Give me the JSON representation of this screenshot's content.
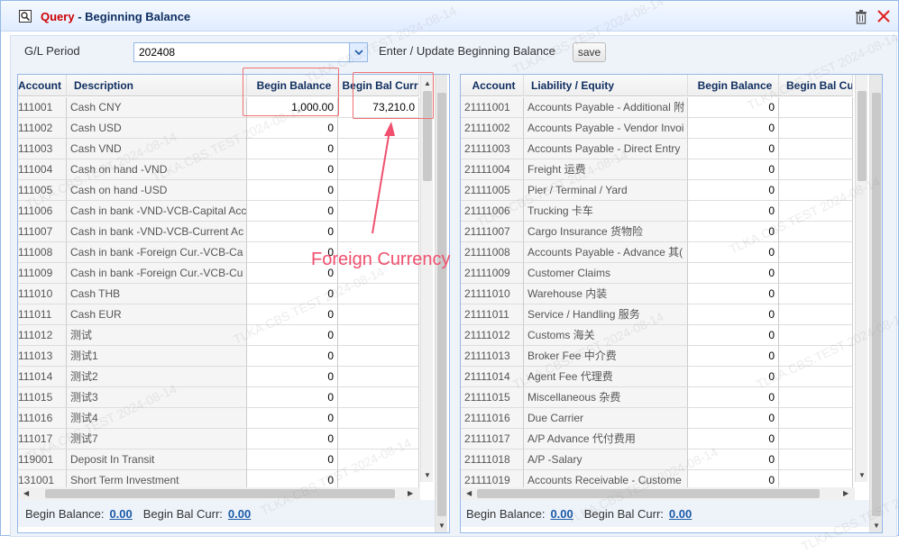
{
  "window": {
    "title_prefix": "Query",
    "title_sep": " - ",
    "title_main": "Beginning Balance"
  },
  "filter": {
    "period_label": "G/L Period",
    "period_value": "202408",
    "enter_label": "Enter / Update Beginning Balance",
    "save_label": "save"
  },
  "annotation": "Foreign Currency",
  "watermark": "TLKA.CBS.TEST 2024-08-14",
  "left_grid": {
    "headers": [
      "Account",
      "Description",
      "Begin Balance",
      "Begin Bal Curr"
    ],
    "rows": [
      [
        "111001",
        "Cash CNY",
        "1,000.00",
        "73,210.0"
      ],
      [
        "111002",
        "Cash USD",
        "0",
        ""
      ],
      [
        "111003",
        "Cash VND",
        "0",
        ""
      ],
      [
        "111004",
        "Cash on hand -VND",
        "0",
        ""
      ],
      [
        "111005",
        "Cash on hand -USD",
        "0",
        ""
      ],
      [
        "111006",
        "Cash in bank -VND-VCB-Capital Acc",
        "0",
        ""
      ],
      [
        "111007",
        "Cash in bank -VND-VCB-Current Ac",
        "0",
        ""
      ],
      [
        "111008",
        "Cash in bank -Foreign Cur.-VCB-Ca",
        "0",
        ""
      ],
      [
        "111009",
        "Cash in bank -Foreign Cur.-VCB-Cu",
        "0",
        ""
      ],
      [
        "111010",
        "Cash THB",
        "0",
        ""
      ],
      [
        "111011",
        "Cash EUR",
        "0",
        ""
      ],
      [
        "111012",
        "测试",
        "0",
        ""
      ],
      [
        "111013",
        "测试1",
        "0",
        ""
      ],
      [
        "111014",
        "测试2",
        "0",
        ""
      ],
      [
        "111015",
        "测试3",
        "0",
        ""
      ],
      [
        "111016",
        "测试4",
        "0",
        ""
      ],
      [
        "111017",
        "测试7",
        "0",
        ""
      ],
      [
        "119001",
        "Deposit In Transit",
        "0",
        ""
      ],
      [
        "131001",
        "Short Term Investment",
        "0",
        ""
      ]
    ],
    "footer": {
      "begin_balance_label": "Begin Balance:",
      "begin_balance_value": "0.00",
      "begin_bal_curr_label": "Begin Bal Curr:",
      "begin_bal_curr_value": "0.00"
    }
  },
  "right_grid": {
    "headers": [
      "Account",
      "Liability / Equity",
      "Begin Balance",
      "Begin Bal Cu"
    ],
    "rows": [
      [
        "21111001",
        "Accounts Payable - Additional 附",
        "0",
        ""
      ],
      [
        "21111002",
        "Accounts Payable - Vendor Invoi",
        "0",
        ""
      ],
      [
        "21111003",
        "Accounts Payable - Direct Entry",
        "0",
        ""
      ],
      [
        "21111004",
        "Freight 运费",
        "0",
        ""
      ],
      [
        "21111005",
        "Pier / Terminal / Yard",
        "0",
        ""
      ],
      [
        "21111006",
        "Trucking 卡车",
        "0",
        ""
      ],
      [
        "21111007",
        "Cargo Insurance 货物险",
        "0",
        ""
      ],
      [
        "21111008",
        "Accounts Payable - Advance 其(",
        "0",
        ""
      ],
      [
        "21111009",
        "Customer Claims",
        "0",
        ""
      ],
      [
        "21111010",
        "Warehouse 内装",
        "0",
        ""
      ],
      [
        "21111011",
        "Service / Handling 服务",
        "0",
        ""
      ],
      [
        "21111012",
        "Customs 海关",
        "0",
        ""
      ],
      [
        "21111013",
        "Broker Fee 中介费",
        "0",
        ""
      ],
      [
        "21111014",
        "Agent Fee 代理费",
        "0",
        ""
      ],
      [
        "21111015",
        "Miscellaneous 杂费",
        "0",
        ""
      ],
      [
        "21111016",
        "Due Carrier",
        "0",
        ""
      ],
      [
        "21111017",
        "A/P Advance 代付费用",
        "0",
        ""
      ],
      [
        "21111018",
        "A/P -Salary",
        "0",
        ""
      ],
      [
        "21111019",
        "Accounts Receivable - Custome",
        "0",
        ""
      ]
    ],
    "footer": {
      "begin_balance_label": "Begin Balance:",
      "begin_balance_value": "0.00",
      "begin_bal_curr_label": "Begin Bal Curr:",
      "begin_bal_curr_value": "0.00"
    }
  }
}
